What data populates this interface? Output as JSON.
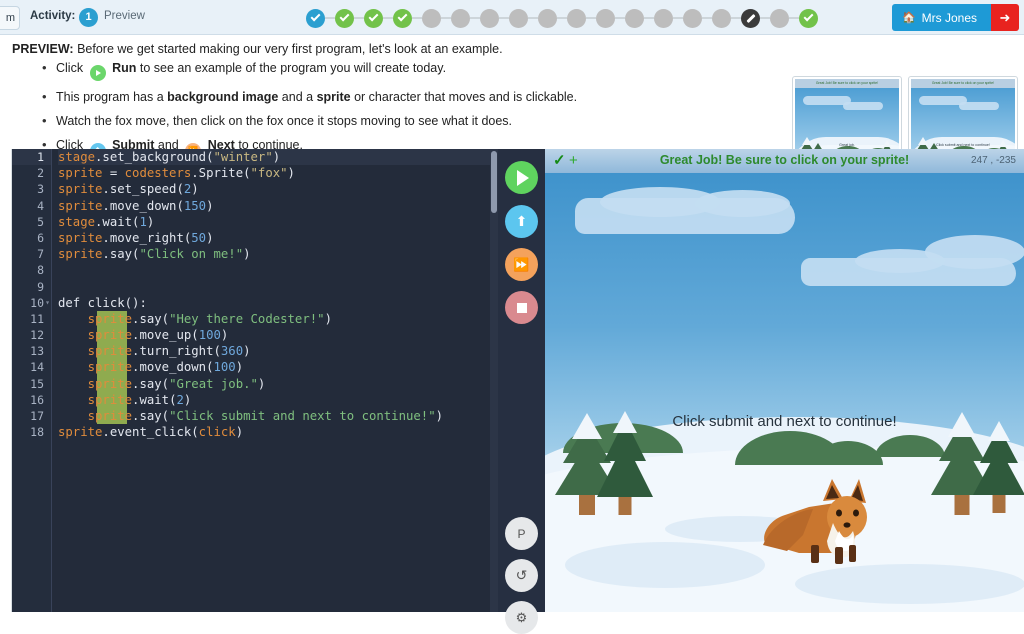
{
  "header": {
    "home_stub_label": "m",
    "activity_label": "Activity:",
    "activity_number": "1",
    "activity_name": "Preview",
    "user_button_label": "Mrs Jones",
    "home_icon": "home-icon",
    "logout_icon": "logout-icon",
    "progress_steps": [
      {
        "state": "teal",
        "icon": "check-icon"
      },
      {
        "state": "green",
        "icon": "check-icon"
      },
      {
        "state": "green",
        "icon": "check-icon"
      },
      {
        "state": "green",
        "icon": "check-icon"
      },
      {
        "state": "gray",
        "icon": ""
      },
      {
        "state": "gray",
        "icon": ""
      },
      {
        "state": "gray",
        "icon": ""
      },
      {
        "state": "gray",
        "icon": ""
      },
      {
        "state": "gray",
        "icon": ""
      },
      {
        "state": "gray",
        "icon": ""
      },
      {
        "state": "gray",
        "icon": ""
      },
      {
        "state": "gray",
        "icon": ""
      },
      {
        "state": "gray",
        "icon": ""
      },
      {
        "state": "gray",
        "icon": ""
      },
      {
        "state": "gray",
        "icon": ""
      },
      {
        "state": "dark",
        "icon": "pencil-icon"
      },
      {
        "state": "gray",
        "icon": ""
      },
      {
        "state": "green",
        "icon": "check-icon"
      }
    ]
  },
  "instructions": {
    "preview_prefix": "PREVIEW:",
    "preview_text": "Before we get started making our very first program, let's look at an example.",
    "bullets": [
      {
        "before": "Click",
        "icon": "run-icon",
        "bold": "Run",
        "after": "to see an example of the program you will create today."
      },
      {
        "before": "This program has a",
        "bold": "background image",
        "mid": "and a",
        "bold2": "sprite",
        "after": "or character that moves and is clickable."
      },
      {
        "before": "Watch the fox move, then click on the fox once it stops moving to see what it does."
      },
      {
        "before": "Click",
        "icon": "submit-icon",
        "bold": "Submit",
        "mid": "and",
        "icon2": "next-icon",
        "bold2": "Next",
        "after": "to continue."
      }
    ],
    "thumbnails": [
      {
        "bar_text": "Great Job! Be sure to click on your sprite!",
        "label": "Great job."
      },
      {
        "bar_text": "Great Job! Be sure to click on your sprite!",
        "label": "Click submit and next to continue!"
      }
    ]
  },
  "editor": {
    "line_numbers": [
      "1",
      "2",
      "3",
      "4",
      "5",
      "6",
      "7",
      "8",
      "9",
      "10",
      "11",
      "12",
      "13",
      "14",
      "15",
      "16",
      "17",
      "18"
    ],
    "lines": [
      "stage.set_background(\"winter\")",
      "sprite = codesters.Sprite(\"fox\")",
      "sprite.set_speed(2)",
      "sprite.move_down(150)",
      "stage.wait(1)",
      "sprite.move_right(50)",
      "sprite.say(\"Click on me!\")",
      "",
      "",
      "def click():",
      "    sprite.say(\"Hey there Codester!\")",
      "    sprite.move_up(100)",
      "    sprite.turn_right(360)",
      "    sprite.move_down(100)",
      "    sprite.say(\"Great job.\")",
      "    sprite.wait(2)",
      "    sprite.say(\"Click submit and next to continue!\")",
      "sprite.event_click(click)"
    ],
    "current_line": "1",
    "fold_marker_line": "10"
  },
  "buttons": {
    "run": {
      "name": "run-button",
      "icon": "play-icon",
      "color": "#5fd35f"
    },
    "submit": {
      "name": "submit-button",
      "icon": "upload-icon",
      "color": "#5cc6ef"
    },
    "next": {
      "name": "next-button",
      "icon": "fast-forward-icon",
      "color": "#f4a25c"
    },
    "stop": {
      "name": "stop-button",
      "icon": "stop-icon",
      "color": "#d98a8f"
    },
    "python": {
      "name": "python-toggle-button",
      "label": "P"
    },
    "reset": {
      "name": "reset-button",
      "icon": "reset-icon",
      "label": "↺"
    },
    "settings": {
      "name": "settings-button",
      "icon": "gear-icon",
      "label": "⚙"
    }
  },
  "stage": {
    "status_check": "✓",
    "status_plus": "+",
    "status_message": "Great Job! Be sure to click on your sprite!",
    "coordinates": "247 , -235",
    "sprite_text": "Click submit and next to continue!",
    "background_name": "winter",
    "sprite_name": "fox"
  },
  "colors": {
    "header_bg": "#e8f1f8",
    "accent_blue": "#1e9ad6",
    "logout_red": "#e8231f",
    "progress_green": "#72c24a",
    "progress_teal": "#2b9fd0",
    "editor_bg": "#232b3a",
    "indent_guide": "#8fab4f",
    "status_green": "#2d8a2d"
  }
}
